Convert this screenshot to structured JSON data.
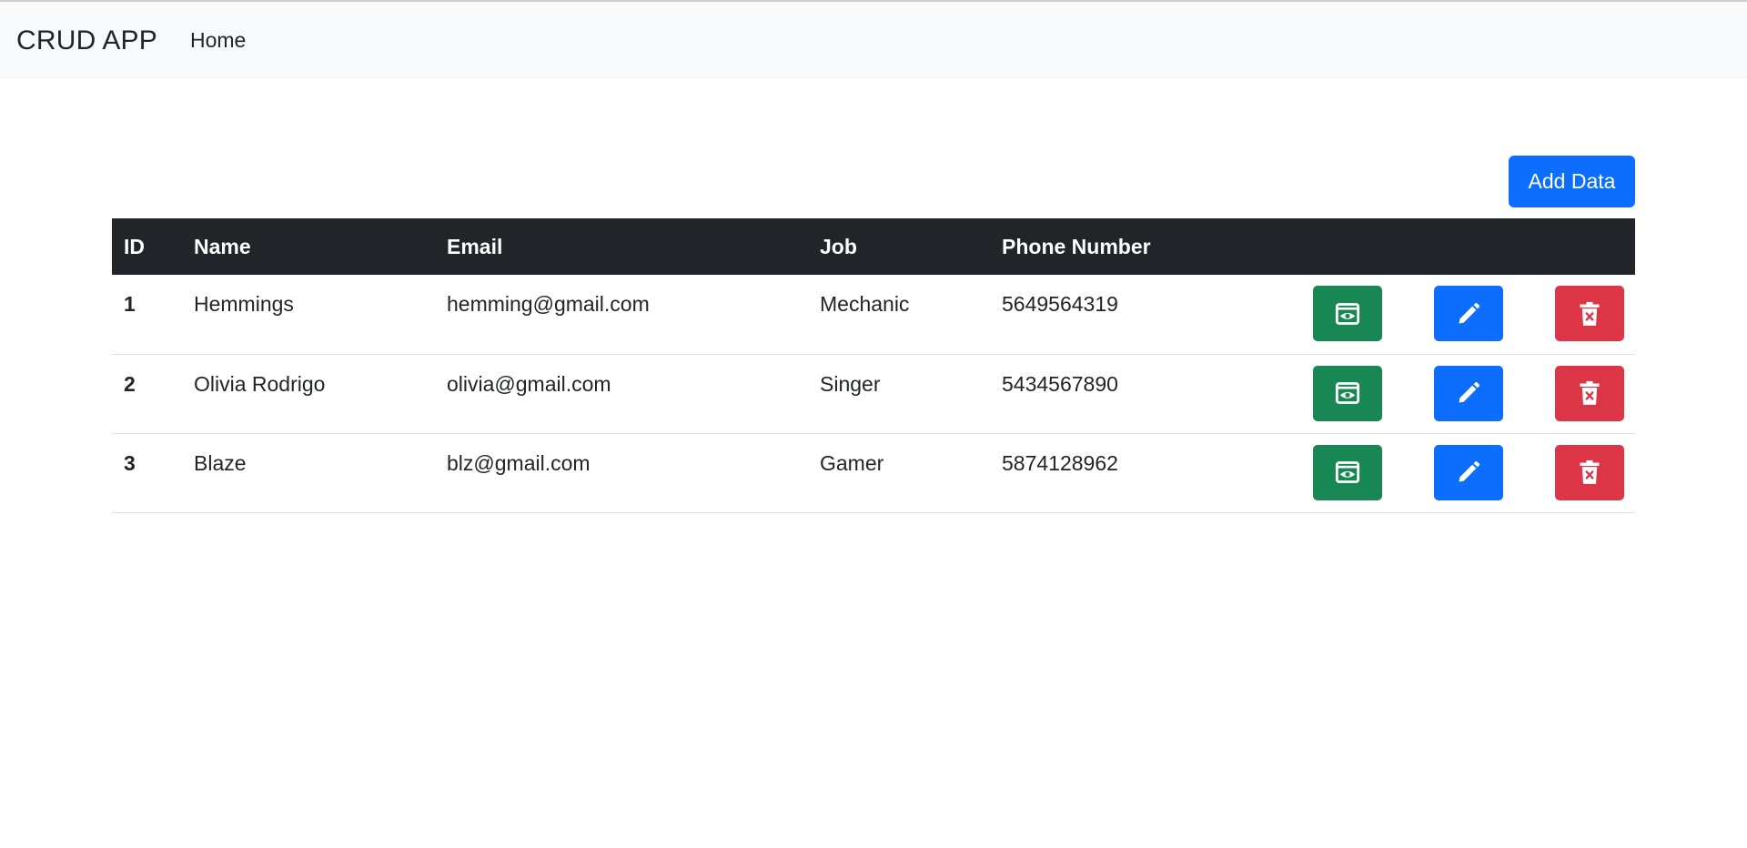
{
  "navbar": {
    "brand": "CRUD APP",
    "home_link": "Home"
  },
  "toolbar": {
    "add_label": "Add Data"
  },
  "table": {
    "headers": {
      "id": "ID",
      "name": "Name",
      "email": "Email",
      "job": "Job",
      "phone": "Phone Number"
    },
    "rows": [
      {
        "id": "1",
        "name": "Hemmings",
        "email": "hemming@gmail.com",
        "job": "Mechanic",
        "phone": "5649564319"
      },
      {
        "id": "2",
        "name": "Olivia Rodrigo",
        "email": "olivia@gmail.com",
        "job": "Singer",
        "phone": "5434567890"
      },
      {
        "id": "3",
        "name": "Blaze",
        "email": "blz@gmail.com",
        "job": "Gamer",
        "phone": "5874128962"
      }
    ]
  },
  "icons": {
    "view": "eye-icon",
    "edit": "pencil-icon",
    "delete": "trash-icon"
  },
  "colors": {
    "primary": "#0d6efd",
    "success": "#198754",
    "danger": "#dc3545",
    "dark": "#212529",
    "navbar_bg": "#f8f9fa"
  }
}
